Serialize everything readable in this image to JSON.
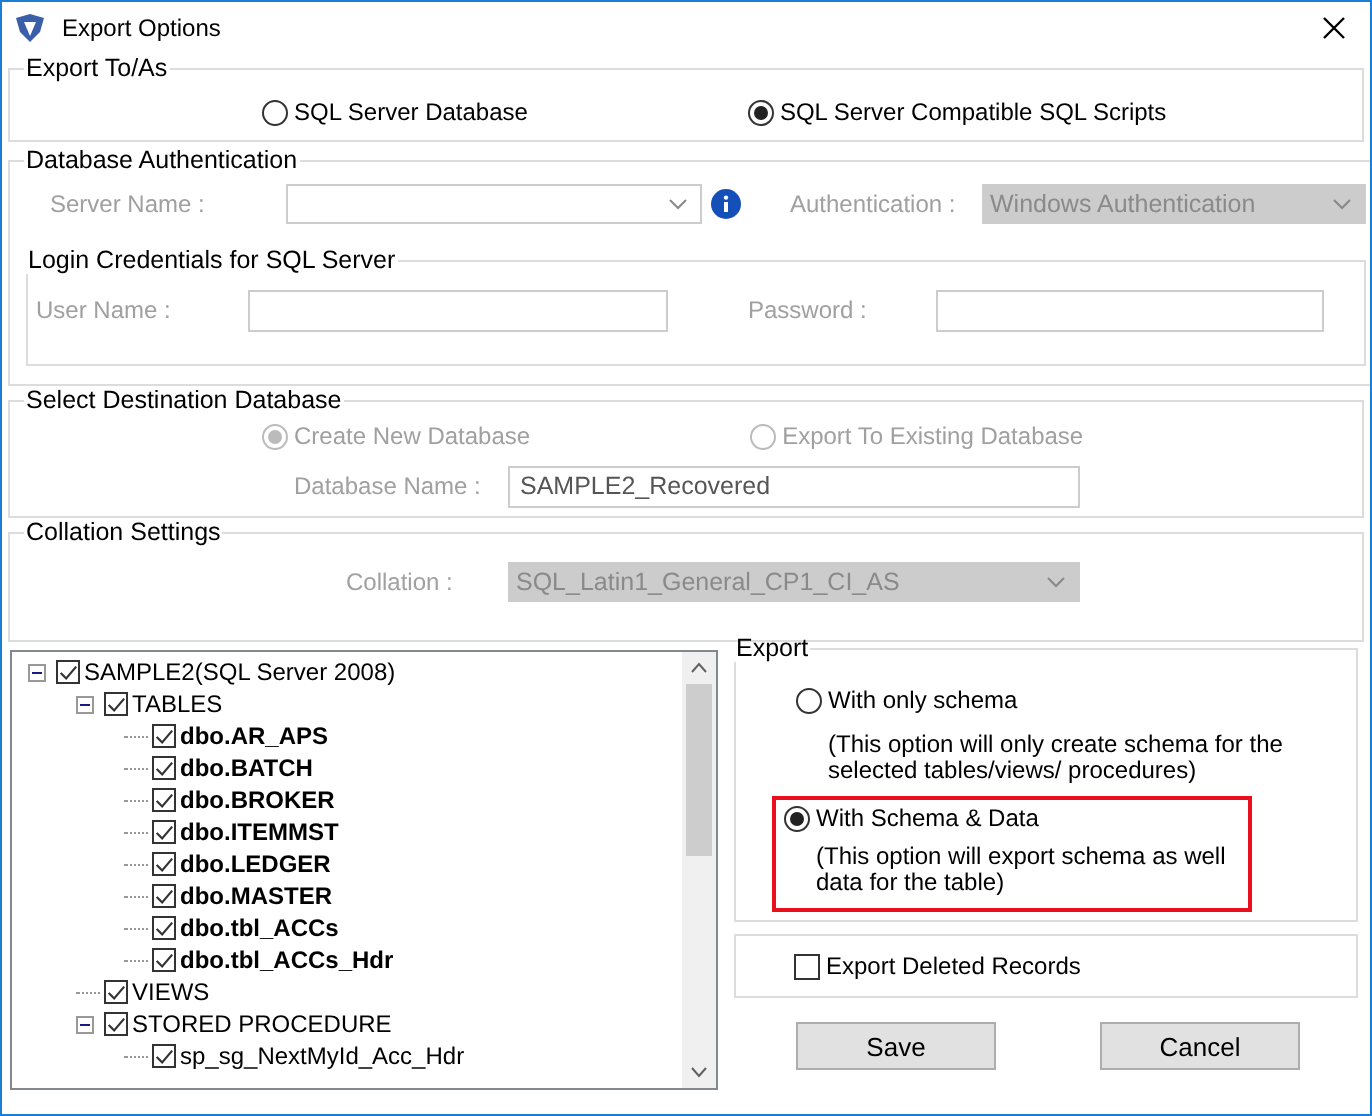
{
  "window": {
    "title": "Export Options"
  },
  "export_to": {
    "title": "Export To/As",
    "options": [
      {
        "label": "SQL Server Database",
        "selected": false
      },
      {
        "label": "SQL Server Compatible SQL Scripts",
        "selected": true
      }
    ]
  },
  "db_auth": {
    "title": "Database Authentication",
    "disabled": true,
    "server_label": "Server Name :",
    "auth_label": "Authentication :",
    "auth_value": "Windows Authentication",
    "login": {
      "title": "Login Credentials for SQL Server",
      "user_label": "User Name :",
      "password_label": "Password :"
    }
  },
  "destination": {
    "title": "Select Destination Database",
    "disabled": true,
    "options": [
      {
        "label": "Create New Database",
        "selected": true
      },
      {
        "label": "Export To Existing Database",
        "selected": false
      }
    ],
    "db_name_label": "Database Name :",
    "db_name_value": "SAMPLE2_Recovered"
  },
  "collation": {
    "title": "Collation Settings",
    "disabled": true,
    "label": "Collation :",
    "value": "SQL_Latin1_General_CP1_CI_AS"
  },
  "tree": {
    "items": [
      {
        "label": "SAMPLE2(SQL Server 2008)",
        "kind": "folder",
        "checked": true,
        "expanded": true,
        "children": [
          {
            "label": "TABLES",
            "kind": "folder",
            "checked": true,
            "expanded": true,
            "children": [
              {
                "label": "dbo.AR_APS",
                "kind": "table",
                "checked": true
              },
              {
                "label": "dbo.BATCH",
                "kind": "table",
                "checked": true
              },
              {
                "label": "dbo.BROKER",
                "kind": "table",
                "checked": true
              },
              {
                "label": "dbo.ITEMMST",
                "kind": "table",
                "checked": true
              },
              {
                "label": "dbo.LEDGER",
                "kind": "table",
                "checked": true
              },
              {
                "label": "dbo.MASTER",
                "kind": "table",
                "checked": true
              },
              {
                "label": "dbo.tbl_ACCs",
                "kind": "table",
                "checked": true
              },
              {
                "label": "dbo.tbl_ACCs_Hdr",
                "kind": "table",
                "checked": true
              }
            ]
          },
          {
            "label": "VIEWS",
            "kind": "folder",
            "checked": true
          },
          {
            "label": "STORED PROCEDURE",
            "kind": "folder",
            "checked": true,
            "expanded": true,
            "children": [
              {
                "label": "sp_sg_NextMyId_Acc_Hdr",
                "kind": "procedure",
                "checked": true
              }
            ]
          }
        ]
      }
    ]
  },
  "export": {
    "title": "Export",
    "options": [
      {
        "label": "With only schema",
        "description": "(This option will only create schema for the  selected tables/views/ procedures)",
        "selected": false,
        "highlighted": false
      },
      {
        "label": "With Schema & Data",
        "description": "(This option will export schema as well data for the table)",
        "selected": true,
        "highlighted": true
      }
    ]
  },
  "export_deleted": {
    "label": "Export Deleted Records",
    "checked": false
  },
  "buttons": [
    "Save",
    "Cancel"
  ]
}
